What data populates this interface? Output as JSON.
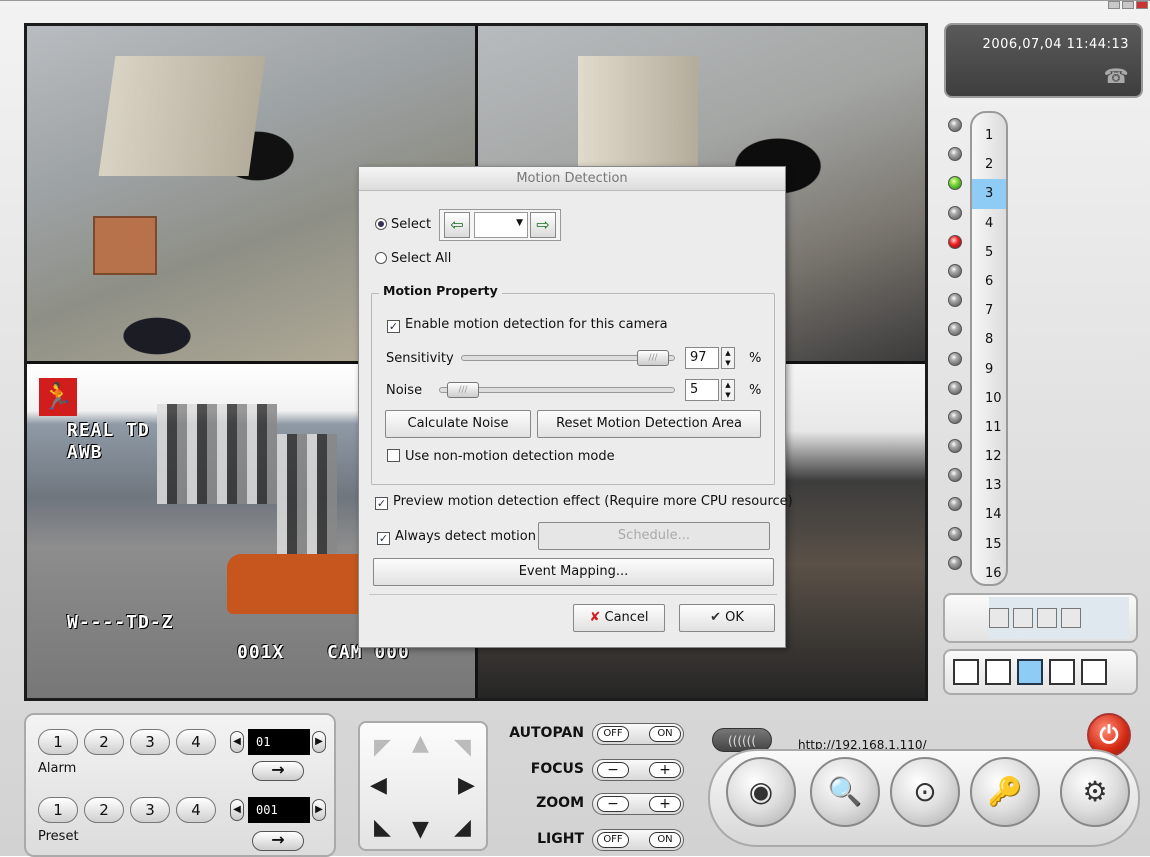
{
  "datetime": "2006,07,04  11:44:13",
  "status_url": "http://192.168.1.110/",
  "prev_label": "((((((",
  "cameras": [
    "1",
    "2",
    "3",
    "4",
    "5",
    "6",
    "7",
    "8",
    "9",
    "10",
    "11",
    "12",
    "13",
    "14",
    "15",
    "16"
  ],
  "selected_camera": "3",
  "camera_status": {
    "3": "green",
    "5": "red"
  },
  "osd": {
    "cam3_line1": "REAL TD",
    "cam3_line2": "AWB",
    "cam3_line3": "W----TD-Z",
    "cam3_line4": "001X",
    "cam3_line5": "CAM 000"
  },
  "dialog": {
    "title": "Motion Detection",
    "select_label": "Select",
    "select_all_label": "Select All",
    "selected_mode": "select",
    "combo_value": "",
    "motion_property_legend": "Motion Property",
    "enable_label": "Enable motion detection for this camera",
    "enable_checked": true,
    "sensitivity_label": "Sensitivity",
    "sensitivity_value": "97",
    "noise_label": "Noise",
    "noise_value": "5",
    "percent": "%",
    "calc_noise_label": "Calculate Noise",
    "reset_area_label": "Reset Motion Detection Area",
    "non_motion_label": "Use non-motion detection mode",
    "non_motion_checked": false,
    "preview_label": "Preview motion detection effect (Require more CPU resource)",
    "preview_checked": true,
    "always_label": "Always detect motion",
    "always_checked": true,
    "schedule_label": "Schedule...",
    "event_mapping_label": "Event Mapping...",
    "cancel_label": "Cancel",
    "ok_label": "OK"
  },
  "alarm": {
    "buttons": [
      "1",
      "2",
      "3",
      "4"
    ],
    "value": "01",
    "label": "Alarm"
  },
  "preset": {
    "buttons": [
      "1",
      "2",
      "3",
      "4"
    ],
    "value": "001",
    "label": "Preset"
  },
  "controls": {
    "autopan": "AUTOPAN",
    "focus": "FOCUS",
    "zoom": "ZOOM",
    "light": "LIGHT",
    "off": "OFF",
    "on": "ON",
    "minus": "−",
    "plus": "+"
  },
  "colors": {
    "accent": "#8ecbf5",
    "power": "#d42a12",
    "led_green": "#6fd43a",
    "led_red": "#ee2424"
  }
}
